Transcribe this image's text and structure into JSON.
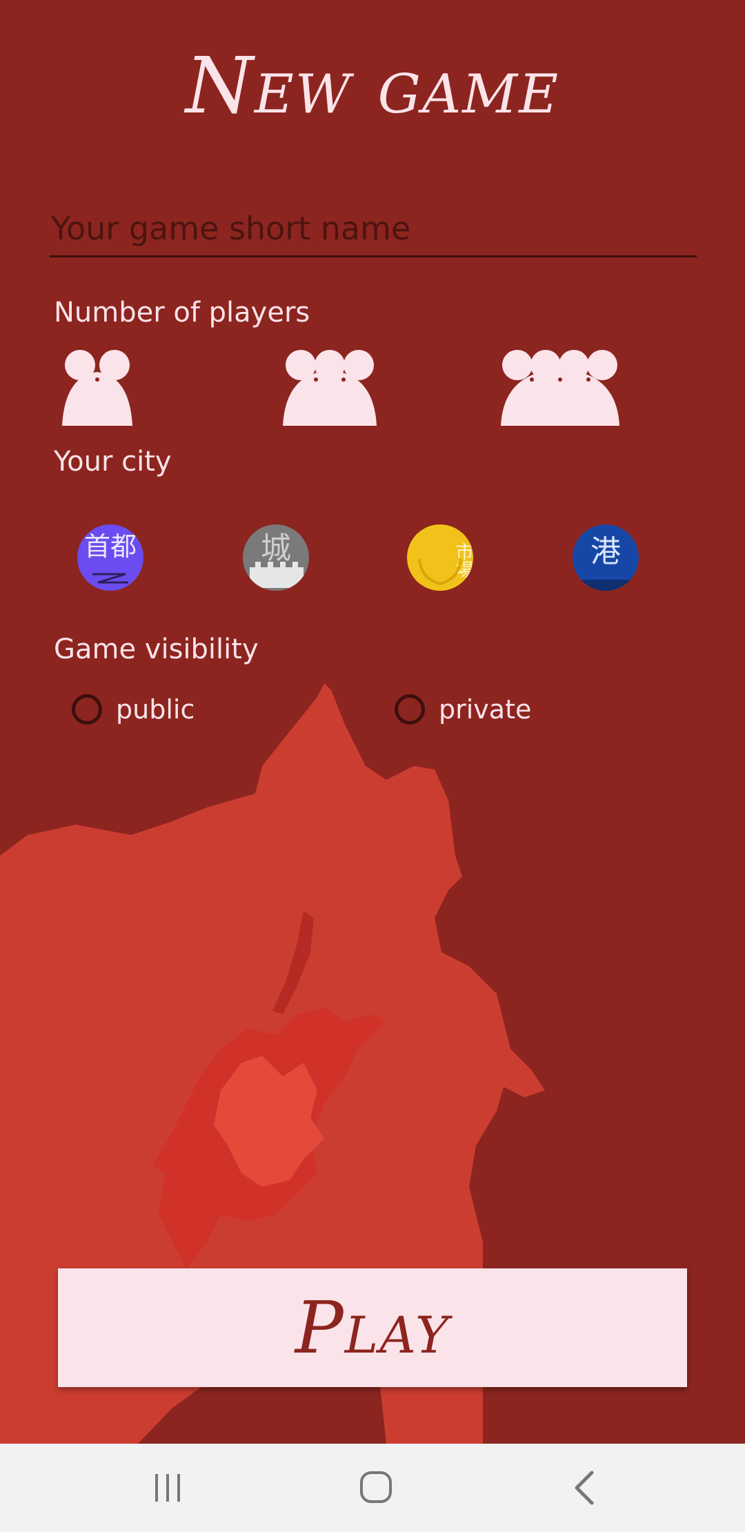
{
  "header": {
    "title": "New game"
  },
  "game_name": {
    "placeholder": "Your game short name",
    "value": ""
  },
  "players": {
    "label": "Number of players",
    "options": [
      {
        "count": 2,
        "icon": "two-player-icon"
      },
      {
        "count": 3,
        "icon": "three-player-icon"
      },
      {
        "count": 4,
        "icon": "four-player-icon"
      }
    ]
  },
  "city": {
    "label": "Your city",
    "options": [
      {
        "glyph": "首都",
        "icon": "capital-city-icon",
        "color": "#6a4cf0"
      },
      {
        "glyph": "城",
        "icon": "castle-city-icon",
        "color": "#7a7a7a"
      },
      {
        "glyph": "市場",
        "icon": "market-city-icon",
        "color": "#f2c21a"
      },
      {
        "glyph": "港",
        "icon": "port-city-icon",
        "color": "#1747a6"
      }
    ]
  },
  "visibility": {
    "label": "Game visibility",
    "options": [
      {
        "label": "public",
        "selected": false
      },
      {
        "label": "private",
        "selected": false
      }
    ]
  },
  "actions": {
    "play_label": "Play"
  },
  "nav": {
    "items": [
      "recent-apps-icon",
      "home-icon",
      "back-icon"
    ]
  },
  "colors": {
    "background": "#8c251f",
    "accent_light": "#fbe3ea",
    "splash": "#cc3d31",
    "splash_bright": "#e34a3a",
    "nav_bar": "#f2f2f2"
  }
}
